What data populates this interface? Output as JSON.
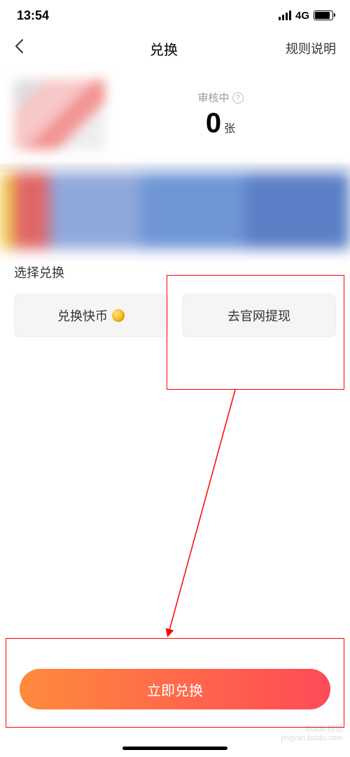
{
  "status_bar": {
    "time": "13:54",
    "network": "4G"
  },
  "nav": {
    "title": "兑换",
    "right_label": "规则说明"
  },
  "account": {
    "review_label": "审核中",
    "count": "0",
    "count_unit": "张"
  },
  "exchange": {
    "section_title": "选择兑换",
    "option_coin": "兑换快币",
    "option_withdraw": "去官网提现"
  },
  "primary_action": "立即兑换",
  "watermark": {
    "line1": "Baidu 经验",
    "line2": "jingyan.baidu.com"
  }
}
